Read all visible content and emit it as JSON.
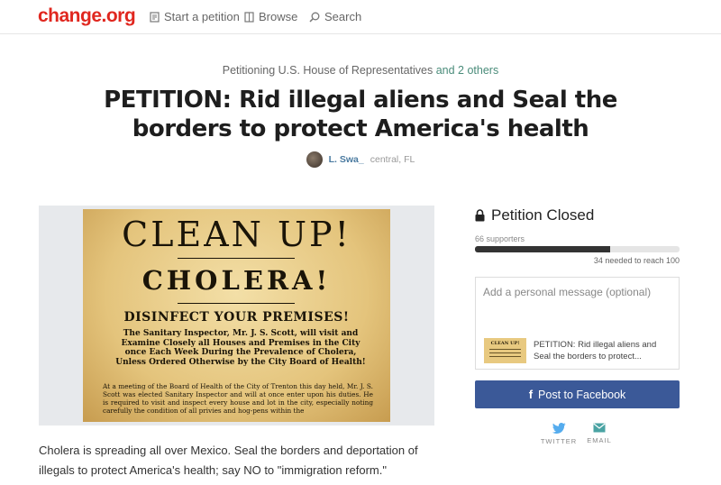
{
  "header": {
    "logo": "change.org",
    "nav": [
      {
        "label": "Start a petition",
        "icon": "petition-icon"
      },
      {
        "label": "Browse",
        "icon": "browse-icon"
      },
      {
        "label": "Search",
        "icon": "search-icon"
      }
    ]
  },
  "petition": {
    "petitioning_prefix": "Petitioning U.S. House of Representatives",
    "petitioning_others": "and 2 others",
    "title": "PETITION: Rid illegal aliens and Seal the borders to protect America's health",
    "author": "L. Swa_",
    "location": "central, FL",
    "description": "Cholera is spreading all over Mexico.  Seal the borders and deportation of illegals to protect America's health; say NO to \"immigration reform.\""
  },
  "poster": {
    "line1": "CLEAN UP!",
    "line2": "CHOLERA!",
    "line3": "DISINFECT YOUR PREMISES!",
    "line4": "The Sanitary Inspector, Mr. J. S. Scott, will visit and Examine Closely all Houses and Premises in the City once Each Week During the Prevalence of Cholera, Unless Ordered Otherwise by the City Board of Health!",
    "line5": "At a meeting of the Board of Health of the City of Trenton this day held, Mr. J. S. Scott was elected Sanitary Inspector and will at once enter upon his duties.  He is required to visit and inspect every house and lot in the city, especially noting carefully the condition of all privies and hog-pens within the"
  },
  "status": {
    "lock_icon": "lock-icon",
    "closed_label": "Petition Closed",
    "supporters": "66 supporters",
    "progress_fraction": 0.66,
    "needed": "34 needed to reach 100"
  },
  "share": {
    "message_placeholder": "Add a personal message (optional)",
    "preview_title": "PETITION: Rid illegal aliens and Seal the borders to protect...",
    "facebook_label": "Post to Facebook",
    "twitter_label": "TWITTER",
    "email_label": "EMAIL"
  },
  "colors": {
    "brand": "#e0271f",
    "facebook": "#3b5998",
    "twitter": "#55acee",
    "email": "#4aa3a3",
    "link": "#4a8c7a"
  }
}
